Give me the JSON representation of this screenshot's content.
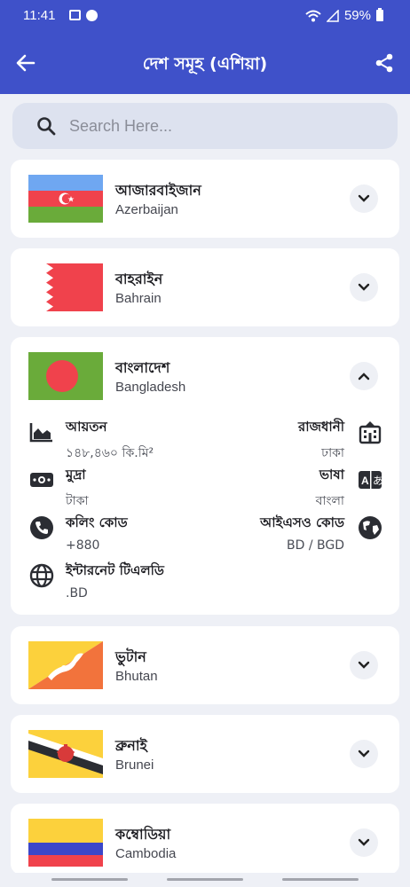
{
  "status": {
    "time": "11:41",
    "battery": "59%"
  },
  "appbar": {
    "title": "দেশ সমূহ (এশিয়া)",
    "back_icon": "arrow-left-icon",
    "share_icon": "share-icon"
  },
  "search": {
    "placeholder": "Search Here..."
  },
  "countries": [
    {
      "name_bn": "আজারবাইজান",
      "name_en": "Azerbaijan",
      "expanded": false
    },
    {
      "name_bn": "বাহরাইন",
      "name_en": "Bahrain",
      "expanded": false
    },
    {
      "name_bn": "বাংলাদেশ",
      "name_en": "Bangladesh",
      "expanded": true,
      "details": {
        "area": {
          "label": "আয়তন",
          "value": "১৪৮,৪৬০ কি.মি²"
        },
        "capital": {
          "label": "রাজধানী",
          "value": "ঢাকা"
        },
        "currency": {
          "label": "মুদ্রা",
          "value": "টাকা"
        },
        "language": {
          "label": "ভাষা",
          "value": "বাংলা"
        },
        "calling_code": {
          "label": "কলিং কোড",
          "value": "+880"
        },
        "iso_code": {
          "label": "আইএসও কোড",
          "value": "BD / BGD"
        },
        "tld": {
          "label": "ইন্টারনেট টিএলডি",
          "value": ".BD"
        }
      }
    },
    {
      "name_bn": "ভুটান",
      "name_en": "Bhutan",
      "expanded": false
    },
    {
      "name_bn": "ব্রুনাই",
      "name_en": "Brunei",
      "expanded": false
    },
    {
      "name_bn": "কম্বোডিয়া",
      "name_en": "Cambodia",
      "expanded": false
    }
  ],
  "colors": {
    "primary": "#3f51c9",
    "background": "#eef0f6",
    "bangladesh_green": "#6aab3a",
    "bangladesh_red": "#f0424c"
  }
}
